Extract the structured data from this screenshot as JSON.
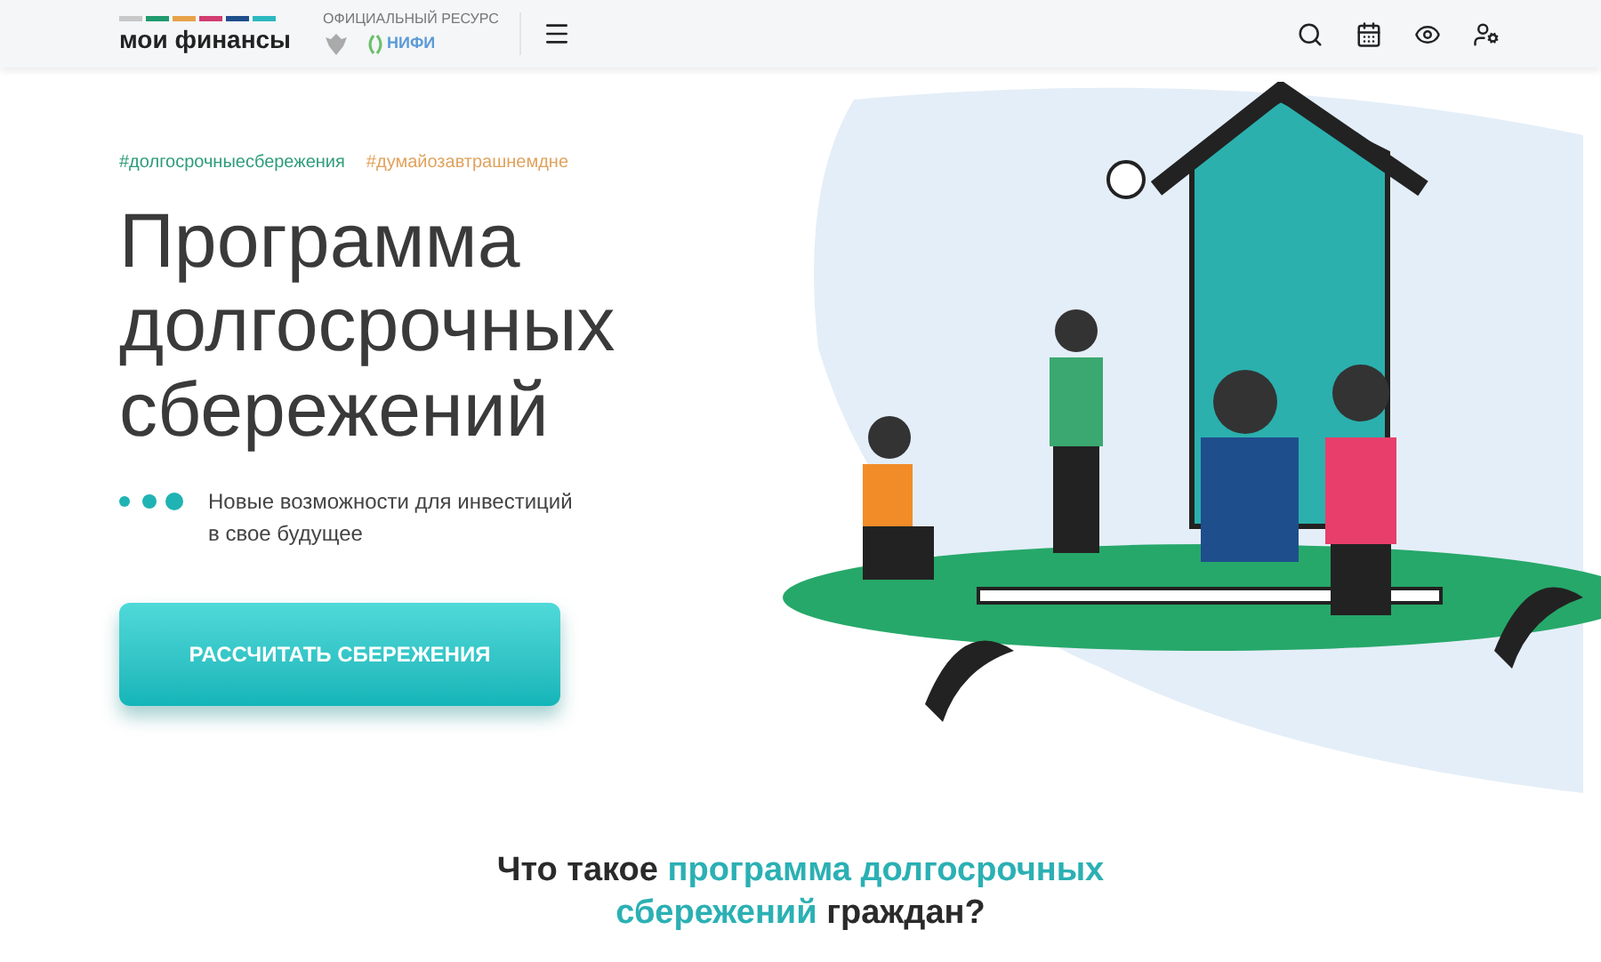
{
  "header": {
    "logo": {
      "text": "мои финансы"
    },
    "official": {
      "caption": "ОФИЦИАЛЬНЫЙ РЕСУРС",
      "partner": "НИФИ"
    }
  },
  "hero": {
    "hashtags": [
      {
        "text": "#долгосрочныесбережения",
        "color": "#2e9c7a"
      },
      {
        "text": "#думайозавтрашнемдне",
        "color": "#e0a25c"
      }
    ],
    "title_lines": [
      "Программа",
      "долгосрочных",
      "сбережений"
    ],
    "subtitle_lines": [
      "Новые возможности для инвестиций",
      "в свое будущее"
    ],
    "cta": "РАССЧИТАТЬ СБЕРЕЖЕНИЯ"
  },
  "section": {
    "heading_parts": [
      {
        "text": "Что такое",
        "highlight": false
      },
      {
        "text": "программа долгосрочных",
        "highlight": true
      },
      {
        "text": "сбережений",
        "highlight": true
      },
      {
        "text": "граждан?",
        "highlight": false
      }
    ]
  }
}
